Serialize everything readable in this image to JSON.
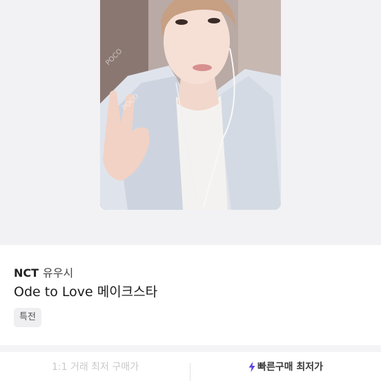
{
  "product": {
    "brand": "NCT",
    "member": "유우시",
    "title": "Ode to Love 메이크스타",
    "tag": "특전",
    "photo_watermark": "POCO"
  },
  "actions": {
    "left_label": "1:1 거래 최저 구매가",
    "right_label": "빠른구매 최저가",
    "right_icon": "lightning-icon",
    "accent_color": "#5b3fe6"
  }
}
